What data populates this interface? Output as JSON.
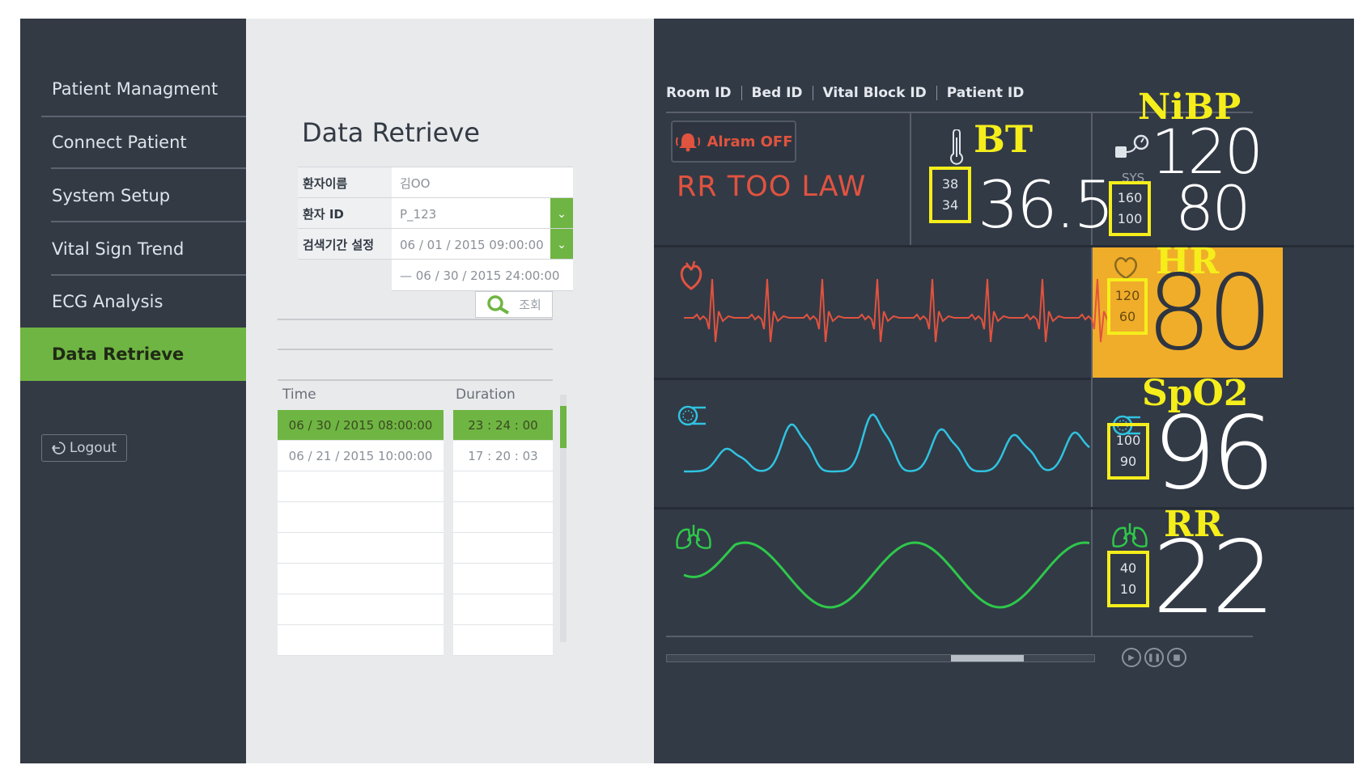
{
  "sidebar": {
    "items": [
      {
        "label": "Patient Managment",
        "active": false
      },
      {
        "label": "Connect Patient",
        "active": false
      },
      {
        "label": "System Setup",
        "active": false
      },
      {
        "label": "Vital Sign Trend",
        "active": false
      },
      {
        "label": "ECG Analysis",
        "active": false
      },
      {
        "label": "Data Retrieve",
        "active": true
      }
    ],
    "logout_label": "Logout",
    "logout_icon": "logout-icon"
  },
  "retrieve": {
    "title": "Data Retrieve",
    "form": {
      "name_label": "환자이름",
      "name_value": "김OO",
      "id_label": "환자 ID",
      "id_value": "P_123",
      "period_label": "검색기간 설정",
      "period_start": "06 / 01 / 2015  09:00:00",
      "period_end": "— 06 / 30 / 2015  24:00:00",
      "search_label": "조회",
      "search_icon": "magnifier-icon"
    },
    "results": {
      "col_time": "Time",
      "col_duration": "Duration",
      "rows": [
        {
          "time": "06 / 30 / 2015  08:00:00",
          "duration": "23 : 24 : 00",
          "selected": true
        },
        {
          "time": "06 / 21 / 2015  10:00:00",
          "duration": "17 : 20 : 03",
          "selected": false
        }
      ]
    }
  },
  "monitor": {
    "header": [
      "Room ID",
      "Bed ID",
      "Vital Block ID",
      "Patient ID"
    ],
    "alarm_button": "Alram OFF",
    "alarm_message": "RR TOO LAW",
    "colors": {
      "hr_highlight": "#f0ad2a",
      "ecg": "#e0533f",
      "spo2": "#2fc3e0",
      "resp": "#2ec84a",
      "annotation": "#f5ee1b"
    },
    "bt": {
      "annotation": "BT",
      "value": "36.5",
      "high": "38",
      "low": "34",
      "icon": "thermometer-icon"
    },
    "nibp": {
      "annotation": "NiBP",
      "sys": "120",
      "dia": "80",
      "high": "160",
      "low": "100",
      "label": "SYS",
      "icon": "blood-pressure-icon"
    },
    "hr": {
      "annotation": "HR",
      "value": "80",
      "high": "120",
      "low": "60",
      "icon": "heart-icon"
    },
    "spo2": {
      "annotation": "SpO2",
      "value": "96",
      "high": "100",
      "low": "90",
      "icon": "finger-sensor-icon"
    },
    "rr": {
      "annotation": "RR",
      "value": "22",
      "high": "40",
      "low": "10",
      "icon": "lungs-icon"
    },
    "playback_progress": 0.75,
    "playback_buttons": [
      "play-icon",
      "pause-icon",
      "stop-icon"
    ]
  }
}
